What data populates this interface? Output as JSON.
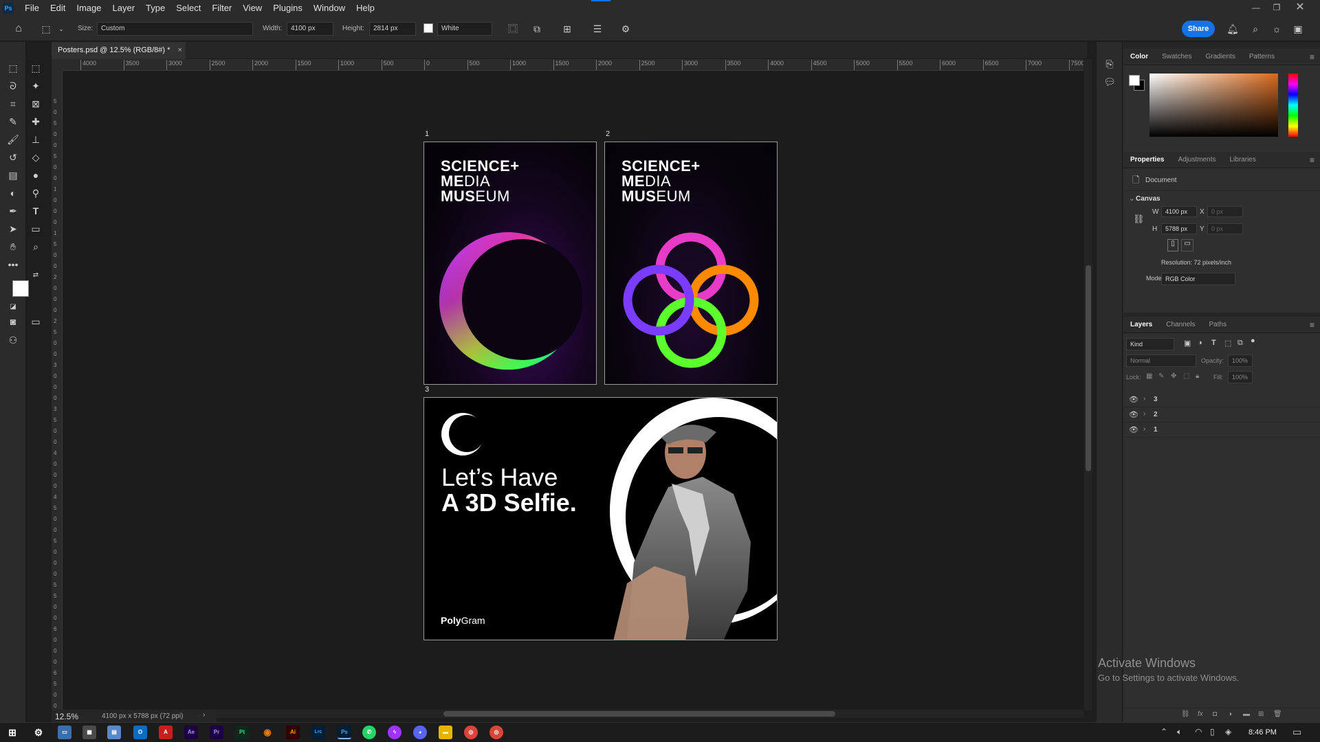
{
  "app": {
    "logo": "Ps",
    "menu": [
      "File",
      "Edit",
      "Image",
      "Layer",
      "Type",
      "Select",
      "Filter",
      "View",
      "Plugins",
      "Window",
      "Help"
    ]
  },
  "options": {
    "size_label": "Size:",
    "size_value": "Custom",
    "width_label": "Width:",
    "width_value": "4100 px",
    "height_label": "Height:",
    "height_value": "2814 px",
    "fill_value": "White",
    "share": "Share"
  },
  "document": {
    "tab": "Posters.psd @ 12.5% (RGB/8#) *",
    "tab_close": "×",
    "zoom": "12.5%",
    "dims": "4100 px x 5788 px (72 ppi)"
  },
  "ruler": {
    "h_ticks": [
      "4000",
      "3500",
      "3000",
      "2500",
      "2000",
      "1500",
      "1000",
      "500",
      "0",
      "500",
      "1000",
      "1500",
      "2000",
      "2500",
      "3000",
      "3500",
      "4000",
      "4500",
      "5000",
      "5500",
      "6000",
      "6500",
      "7000",
      "7500"
    ],
    "v_ticks": [
      "5",
      "0",
      "5",
      "0",
      "0",
      "5",
      "0",
      "0",
      "1",
      "0",
      "0",
      "0",
      "1",
      "5",
      "0",
      "0",
      "2",
      "0",
      "0",
      "0",
      "2",
      "5",
      "0",
      "0",
      "3",
      "0",
      "0",
      "0",
      "3",
      "5",
      "0",
      "0",
      "4",
      "0",
      "0",
      "0",
      "4",
      "5",
      "0",
      "0",
      "5",
      "0",
      "0",
      "0",
      "5",
      "5",
      "0",
      "0",
      "6",
      "0",
      "0",
      "0",
      "6",
      "5",
      "0",
      "0"
    ]
  },
  "artboards": [
    {
      "label": "1",
      "line1": "SCIENCE+",
      "line2a": "ME",
      "line2b": "DIA",
      "line3a": "MUS",
      "line3b": "EUM"
    },
    {
      "label": "2",
      "line1": "SCIENCE+",
      "line2a": "ME",
      "line2b": "DIA",
      "line3a": "MUS",
      "line3b": "EUM"
    },
    {
      "label": "3",
      "headline1": "Let’s Have",
      "headline2": "A 3D Selfie.",
      "brand_a": "Poly",
      "brand_b": "Gram"
    }
  ],
  "color_panel": {
    "tabs": [
      "Color",
      "Swatches",
      "Gradients",
      "Patterns"
    ]
  },
  "properties_panel": {
    "tabs": [
      "Properties",
      "Adjustments",
      "Libraries"
    ],
    "doc_label": "Document",
    "section": "Canvas",
    "w_label": "W",
    "w_value": "4100 px",
    "h_label": "H",
    "h_value": "5788 px",
    "x_label": "X",
    "x_value": "0 px",
    "y_label": "Y",
    "y_value": "0 px",
    "resolution": "Resolution: 72 pixels/inch",
    "mode_label": "Mode",
    "mode_value": "RGB Color"
  },
  "layers_panel": {
    "tabs": [
      "Layers",
      "Channels",
      "Paths"
    ],
    "filter": "Kind",
    "blend": "Normal",
    "opacity_label": "Opacity:",
    "opacity_value": "100%",
    "lock_label": "Lock:",
    "fill_label": "Fill:",
    "fill_value": "100%",
    "layers": [
      "3",
      "2",
      "1"
    ]
  },
  "watermark": {
    "title": "Activate Windows",
    "subtitle": "Go to Settings to activate Windows."
  },
  "taskbar": {
    "apps": [
      "Ae",
      "Pr",
      "Pt",
      "Ai",
      "Lrc",
      "Ps"
    ],
    "time": "8:46 PM"
  }
}
